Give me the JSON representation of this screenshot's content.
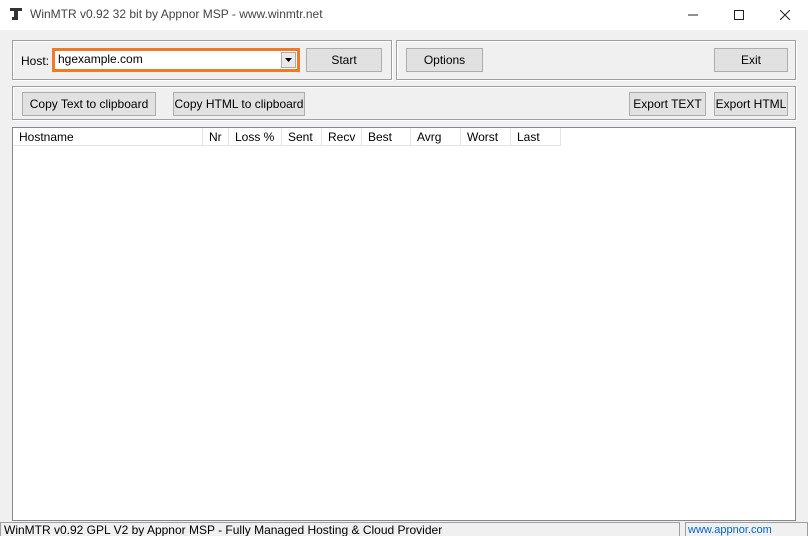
{
  "window": {
    "title": "WinMTR v0.92 32 bit by Appnor MSP - www.winmtr.net"
  },
  "host": {
    "label": "Host:",
    "value": "hgexample.com"
  },
  "buttons": {
    "start": "Start",
    "options": "Options",
    "exit": "Exit",
    "copy_text": "Copy Text to clipboard",
    "copy_html": "Copy HTML to clipboard",
    "export_text": "Export TEXT",
    "export_html": "Export HTML"
  },
  "table": {
    "columns": [
      "Hostname",
      "Nr",
      "Loss %",
      "Sent",
      "Recv",
      "Best",
      "Avrg",
      "Worst",
      "Last"
    ],
    "rows": []
  },
  "statusbar": {
    "left": "WinMTR v0.92 GPL V2 by Appnor MSP - Fully Managed Hosting & Cloud Provider",
    "right": "www.appnor.com"
  },
  "colors": {
    "host_highlight": "#f07a25",
    "link": "#0066cc"
  }
}
